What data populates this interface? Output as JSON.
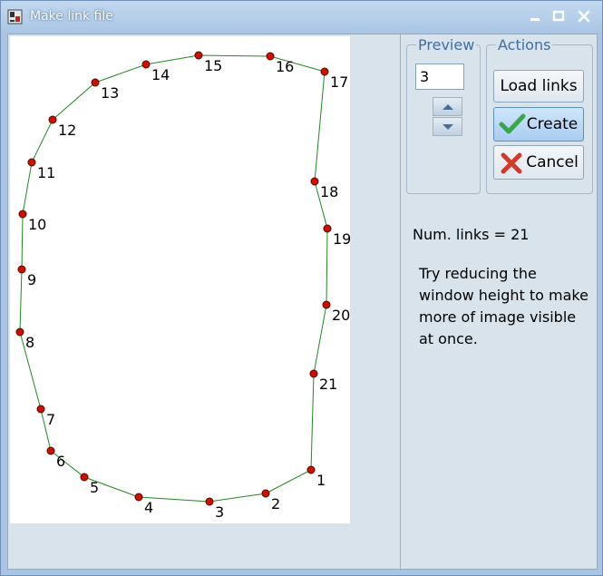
{
  "window": {
    "title": "Make link file",
    "icon": "app-icon",
    "controls": [
      "minimize-icon",
      "maximize-icon",
      "close-icon"
    ]
  },
  "preview": {
    "legend": "Preview",
    "value": "3"
  },
  "actions": {
    "legend": "Actions",
    "load_label": "Load links",
    "create_label": "Create",
    "cancel_label": "Cancel",
    "create_icon": "checkmark-icon",
    "cancel_icon": "x-icon"
  },
  "status": {
    "num_links": "Num. links = 21",
    "hint": "Try reducing the window height to make more of image visible at once."
  },
  "colors": {
    "point_fill": "#cc1100",
    "point_stroke": "#5a0000",
    "link_line": "#228822",
    "checkmark": "#3aa64a",
    "cancel_x": "#d43a2a"
  },
  "points": [
    {
      "label": "1"
    },
    {
      "label": "2"
    },
    {
      "label": "3"
    },
    {
      "label": "4"
    },
    {
      "label": "5"
    },
    {
      "label": "6"
    },
    {
      "label": "7"
    },
    {
      "label": "8"
    },
    {
      "label": "9"
    },
    {
      "label": "10"
    },
    {
      "label": "11"
    },
    {
      "label": "12"
    },
    {
      "label": "13"
    },
    {
      "label": "14"
    },
    {
      "label": "15"
    },
    {
      "label": "16"
    },
    {
      "label": "17"
    },
    {
      "label": "18"
    },
    {
      "label": "19"
    },
    {
      "label": "20"
    },
    {
      "label": "21"
    }
  ]
}
